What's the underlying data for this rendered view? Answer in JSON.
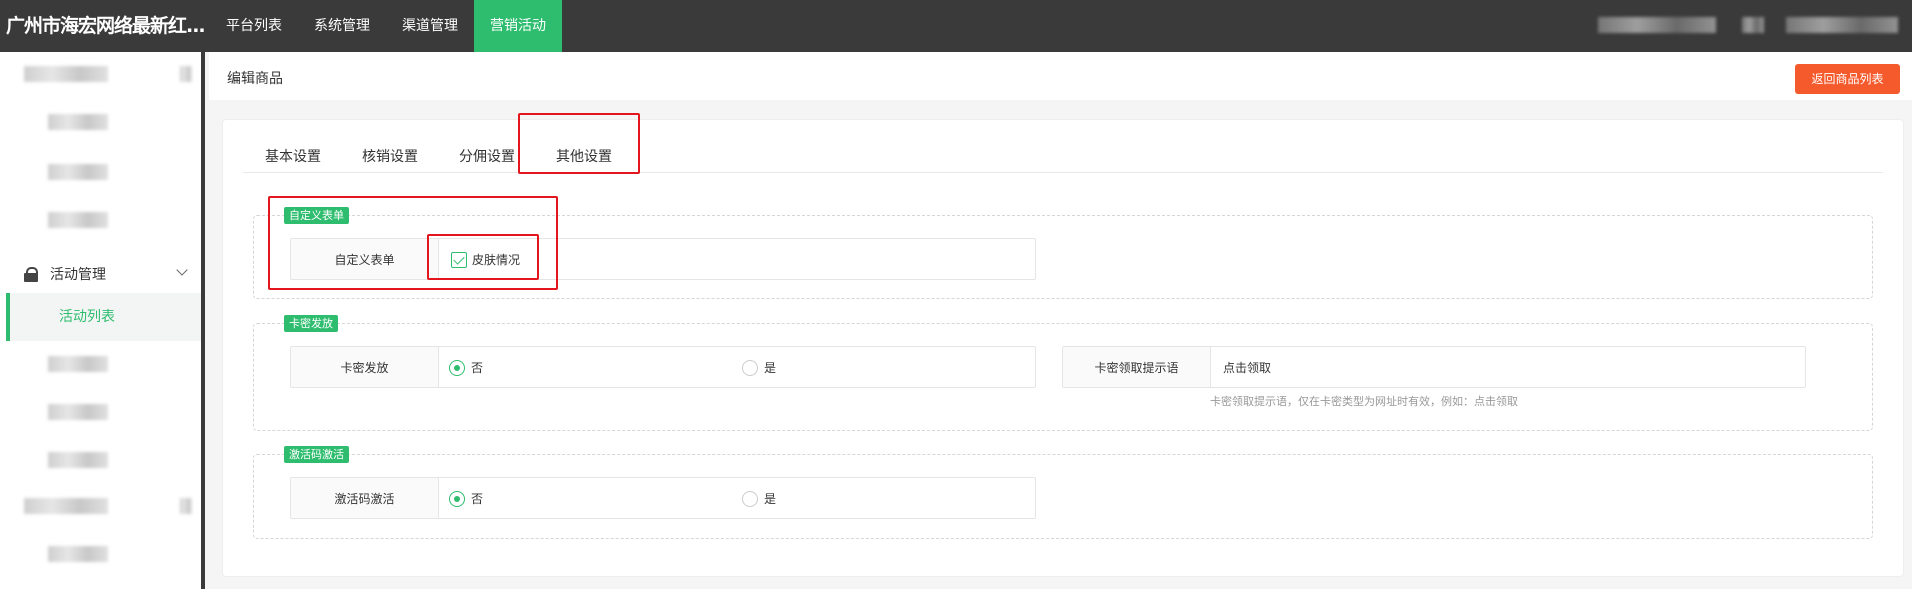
{
  "brand": {
    "title": "广州市海宏网络最新红..."
  },
  "topnav": {
    "items": [
      "平台列表",
      "系统管理",
      "渠道管理",
      "营销活动"
    ],
    "active_index": 3
  },
  "sidebar": {
    "group_label": "活动管理",
    "active_item": "活动列表"
  },
  "page": {
    "title": "编辑商品",
    "back_button": "返回商品列表"
  },
  "tabs": [
    "基本设置",
    "核销设置",
    "分佣设置",
    "其他设置"
  ],
  "sections": {
    "custom_form": {
      "legend": "自定义表单",
      "label": "自定义表单",
      "checkbox_label": "皮肤情况",
      "checked": true
    },
    "card_issue": {
      "legend": "卡密发放",
      "label": "卡密发放",
      "option_no": "否",
      "option_yes": "是",
      "selected": "否",
      "tip_label": "卡密领取提示语",
      "tip_value": "点击领取",
      "tip_hint": "卡密领取提示语，仅在卡密类型为网址时有效，例如：点击领取"
    },
    "activation": {
      "legend": "激活码激活",
      "label": "激活码激活",
      "option_no": "否",
      "option_yes": "是",
      "selected": "否"
    }
  },
  "colors": {
    "accent": "#2ebd6e",
    "topbar": "#3a3a3a",
    "danger_button": "#f55a2c",
    "annotation": "#e4161d"
  }
}
